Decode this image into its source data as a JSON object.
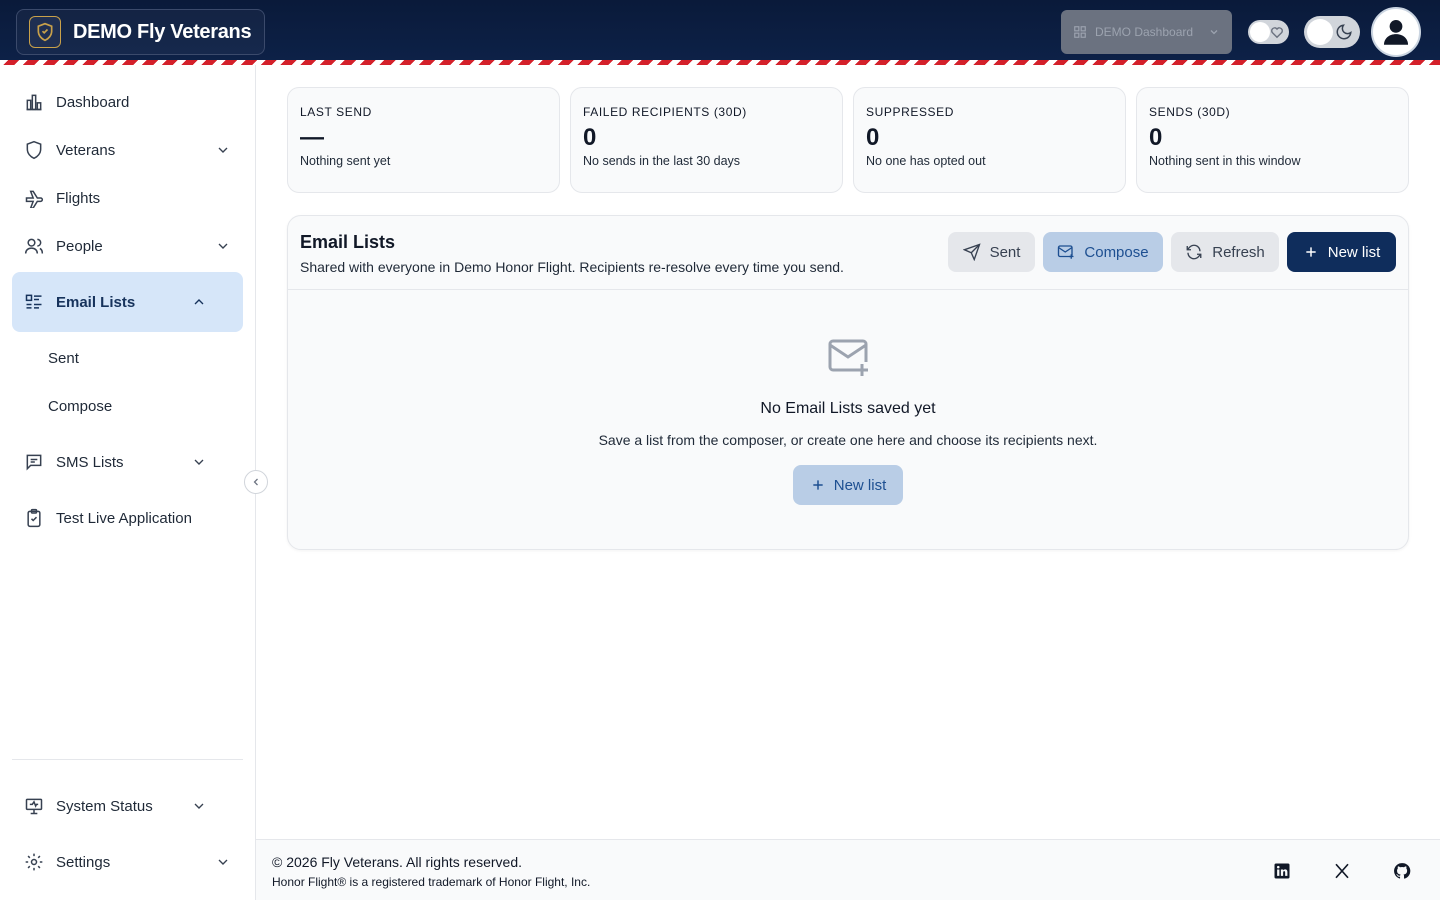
{
  "header": {
    "brand_title": "DEMO Fly Veterans",
    "dashboard_select": "DEMO Dashboard",
    "colors": {
      "header_bg": "#0a1a3a",
      "stripe_red": "#d4202a"
    }
  },
  "sidebar": {
    "items": [
      {
        "label": "Dashboard",
        "icon": "bar-chart-icon"
      },
      {
        "label": "Veterans",
        "icon": "shield-icon"
      },
      {
        "label": "Flights",
        "icon": "plane-icon"
      },
      {
        "label": "People",
        "icon": "users-icon"
      },
      {
        "label": "Email Lists",
        "icon": "list-icon",
        "active": true
      },
      {
        "label": "SMS Lists",
        "icon": "message-icon"
      },
      {
        "label": "Test Live Application",
        "icon": "clipboard-check-icon"
      }
    ],
    "email_sub": [
      "Sent",
      "Compose"
    ],
    "bottom": [
      {
        "label": "System Status",
        "icon": "monitor-icon"
      },
      {
        "label": "Settings",
        "icon": "gear-icon"
      }
    ]
  },
  "stats": [
    {
      "label": "LAST SEND",
      "value": "—",
      "sub": "Nothing sent yet"
    },
    {
      "label": "FAILED RECIPIENTS (30D)",
      "value": "0",
      "sub": "No sends in the last 30 days"
    },
    {
      "label": "SUPPRESSED",
      "value": "0",
      "sub": "No one has opted out"
    },
    {
      "label": "SENDS (30D)",
      "value": "0",
      "sub": "Nothing sent in this window"
    }
  ],
  "email_lists": {
    "title": "Email Lists",
    "description": "Shared with everyone in Demo Honor Flight. Recipients re-resolve every time you send.",
    "buttons": {
      "sent": "Sent",
      "compose": "Compose",
      "refresh": "Refresh",
      "new_list": "New list"
    },
    "empty": {
      "title": "No Email Lists saved yet",
      "description": "Save a list from the composer, or create one here and choose its recipients next.",
      "button": "New list"
    }
  },
  "footer": {
    "copyright": "© 2026 Fly Veterans. All rights reserved.",
    "trademark": "Honor Flight® is a registered trademark of Honor Flight, Inc."
  }
}
